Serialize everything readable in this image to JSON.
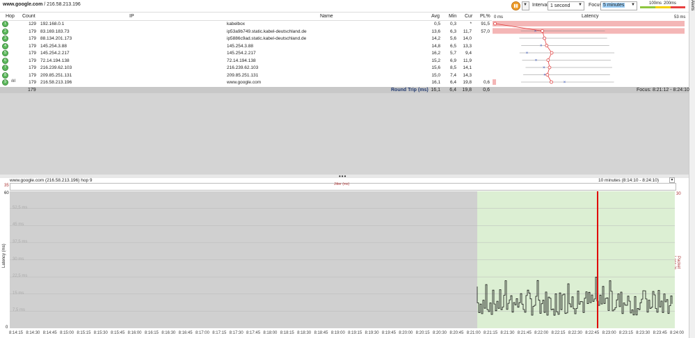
{
  "header": {
    "target_host": "www.google.com",
    "target_ip": " / 216.58.213.196",
    "interval_label": "Interval",
    "interval_value": "1 second",
    "focus_label": "Focus",
    "focus_value": "5 minutes",
    "scale_low": "100ms",
    "scale_high": "200ms",
    "alerts_label": "Alerts"
  },
  "table": {
    "columns": {
      "hop": "Hop",
      "count": "Count",
      "ip": "IP",
      "name": "Name",
      "avg": "Avg",
      "min": "Min",
      "cur": "Cur",
      "pl": "PL%",
      "latency": "Latency"
    },
    "latency_left": "0 ms",
    "latency_right": "53 ms",
    "rows": [
      {
        "hop": "1",
        "count": "129",
        "ip": "192.168.0.1",
        "name": "kabelbox",
        "avg": "0,5",
        "min": "0,3",
        "cur": "*",
        "pl": "91,5",
        "pl_val": 91.5,
        "lat": 0.5
      },
      {
        "hop": "2",
        "count": "179",
        "ip": "83.169.183.73",
        "name": "ip53a9b749.static.kabel-deutschland.de",
        "avg": "13,6",
        "min": "6,3",
        "cur": "11,7",
        "pl": "57,0",
        "pl_val": 57.0,
        "lat": 13.6
      },
      {
        "hop": "3",
        "count": "179",
        "ip": "88.134.201.173",
        "name": "ip5886c9ad.static.kabel-deutschland.de",
        "avg": "14,2",
        "min": "5,6",
        "cur": "14,0",
        "pl": "",
        "pl_val": 0,
        "lat": 14.2
      },
      {
        "hop": "4",
        "count": "179",
        "ip": "145.254.3.88",
        "name": "145.254.3.88",
        "avg": "14,8",
        "min": "6,5",
        "cur": "13,3",
        "pl": "",
        "pl_val": 0,
        "lat": 14.8
      },
      {
        "hop": "5",
        "count": "179",
        "ip": "145.254.2.217",
        "name": "145.254.2.217",
        "avg": "16,2",
        "min": "5,7",
        "cur": "9,4",
        "pl": "",
        "pl_val": 0,
        "lat": 16.2
      },
      {
        "hop": "6",
        "count": "179",
        "ip": "72.14.194.138",
        "name": "72.14.194.138",
        "avg": "15,2",
        "min": "6,9",
        "cur": "11,9",
        "pl": "",
        "pl_val": 0,
        "lat": 15.2
      },
      {
        "hop": "7",
        "count": "179",
        "ip": "216.239.62.103",
        "name": "216.239.62.103",
        "avg": "15,6",
        "min": "8,5",
        "cur": "14,1",
        "pl": "",
        "pl_val": 0,
        "lat": 15.6
      },
      {
        "hop": "8",
        "count": "179",
        "ip": "209.85.251.131",
        "name": "209.85.251.131",
        "avg": "15,0",
        "min": "7,4",
        "cur": "14,3",
        "pl": "",
        "pl_val": 0,
        "lat": 15.0
      },
      {
        "hop": "9",
        "count": "179",
        "ip": "216.58.213.196",
        "name": "www.google.com",
        "avg": "16,1",
        "min": "6,4",
        "cur": "19,8",
        "pl": "0,6",
        "pl_val": 0.6,
        "lat": 16.1
      }
    ],
    "summary": {
      "count": "179",
      "label": "Round Trip (ms)",
      "avg": "16,1",
      "min": "6,4",
      "cur": "19,8",
      "pl": "0,6",
      "focus": "Focus: 8:21:12 - 8:24:10"
    }
  },
  "graph": {
    "title": "www.google.com (216.58.213.196) hop 9",
    "range": "10 minutes (8:14:10 - 8:24:10)",
    "jitter_label": "Jitter (ms)",
    "jitter_max": "35",
    "y_max_label": "60",
    "y_zero_label": "0",
    "pl_max_label": "30",
    "ylabel_left": "Latency (ms)",
    "ylabel_right": "Packet Loss %",
    "y_ticks": [
      "52,5 ms",
      "45 ms",
      "37,5 ms",
      "30 ms",
      "22,5 ms",
      "15 ms",
      "7,5 ms"
    ],
    "x_ticks": [
      "8:14:15",
      "8:14:30",
      "8:14:45",
      "8:15:00",
      "8:15:15",
      "8:15:30",
      "8:15:45",
      "8:16:00",
      "8:16:15",
      "8:16:30",
      "8:16:45",
      "8:17:00",
      "8:17:15",
      "8:17:30",
      "8:17:45",
      "8:18:00",
      "8:18:15",
      "8:18:30",
      "8:18:45",
      "8:19:00",
      "8:19:15",
      "8:19:30",
      "8:19:45",
      "8:20:00",
      "8:20:15",
      "8:20:30",
      "8:20:45",
      "8:21:00",
      "8:21:15",
      "8:21:30",
      "8:21:45",
      "8:22:00",
      "8:22:15",
      "8:22:30",
      "8:22:45",
      "8:23:00",
      "8:23:15",
      "8:23:30",
      "8:23:45",
      "8:24:00"
    ],
    "colors": {
      "focus_bg": "#dcefd3",
      "gray_bg": "#d0d0d0",
      "marker": "#e00000",
      "line": "#111111"
    }
  }
}
